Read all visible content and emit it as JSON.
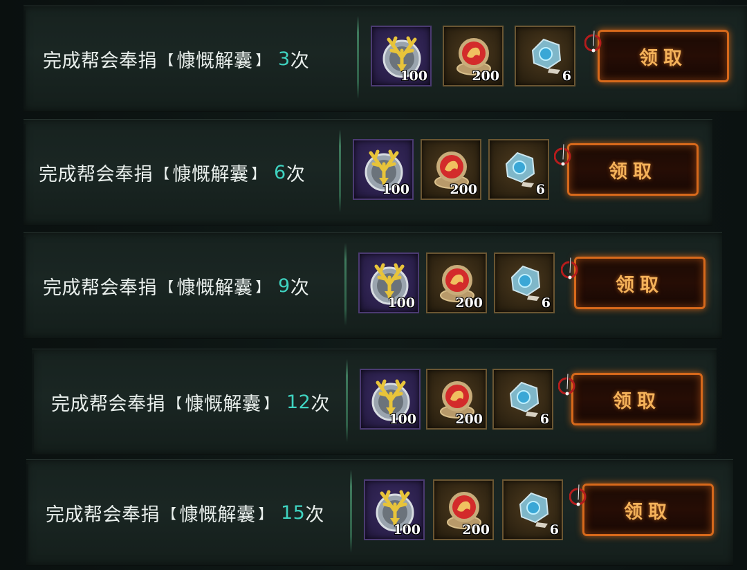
{
  "rows": [
    {
      "task": {
        "prefix": "完成帮会奉捐",
        "lbracket": "【",
        "item": "慷慨解囊",
        "rbracket": "】",
        "count": "3",
        "unit": "次"
      },
      "rewards": [
        {
          "icon": "antler-medal-icon",
          "qty": "100",
          "frame": "purple"
        },
        {
          "icon": "red-lion-emblem-icon",
          "qty": "200",
          "frame": "gold"
        },
        {
          "icon": "blue-crystal-ore-icon",
          "qty": "6",
          "frame": "gold"
        }
      ],
      "claim_label": "领取"
    },
    {
      "task": {
        "prefix": "完成帮会奉捐",
        "lbracket": "【",
        "item": "慷慨解囊",
        "rbracket": "】",
        "count": "6",
        "unit": "次"
      },
      "rewards": [
        {
          "icon": "antler-medal-icon",
          "qty": "100",
          "frame": "purple"
        },
        {
          "icon": "red-lion-emblem-icon",
          "qty": "200",
          "frame": "gold"
        },
        {
          "icon": "blue-crystal-ore-icon",
          "qty": "6",
          "frame": "gold"
        }
      ],
      "claim_label": "领取"
    },
    {
      "task": {
        "prefix": "完成帮会奉捐",
        "lbracket": "【",
        "item": "慷慨解囊",
        "rbracket": "】",
        "count": "9",
        "unit": "次"
      },
      "rewards": [
        {
          "icon": "antler-medal-icon",
          "qty": "100",
          "frame": "purple"
        },
        {
          "icon": "red-lion-emblem-icon",
          "qty": "200",
          "frame": "gold"
        },
        {
          "icon": "blue-crystal-ore-icon",
          "qty": "6",
          "frame": "gold"
        }
      ],
      "claim_label": "领取"
    },
    {
      "task": {
        "prefix": "完成帮会奉捐",
        "lbracket": "【",
        "item": "慷慨解囊",
        "rbracket": "】",
        "count": "12",
        "unit": "次"
      },
      "rewards": [
        {
          "icon": "antler-medal-icon",
          "qty": "100",
          "frame": "purple"
        },
        {
          "icon": "red-lion-emblem-icon",
          "qty": "200",
          "frame": "gold"
        },
        {
          "icon": "blue-crystal-ore-icon",
          "qty": "6",
          "frame": "gold"
        }
      ],
      "claim_label": "领取"
    },
    {
      "task": {
        "prefix": "完成帮会奉捐",
        "lbracket": "【",
        "item": "慷慨解囊",
        "rbracket": "】",
        "count": "15",
        "unit": "次"
      },
      "rewards": [
        {
          "icon": "antler-medal-icon",
          "qty": "100",
          "frame": "purple"
        },
        {
          "icon": "red-lion-emblem-icon",
          "qty": "200",
          "frame": "gold"
        },
        {
          "icon": "blue-crystal-ore-icon",
          "qty": "6",
          "frame": "gold"
        }
      ],
      "claim_label": "领取"
    }
  ],
  "colors": {
    "count_accent": "#3fd3c0",
    "claim_border": "#d7691b",
    "claim_text": "#f4b25a"
  }
}
